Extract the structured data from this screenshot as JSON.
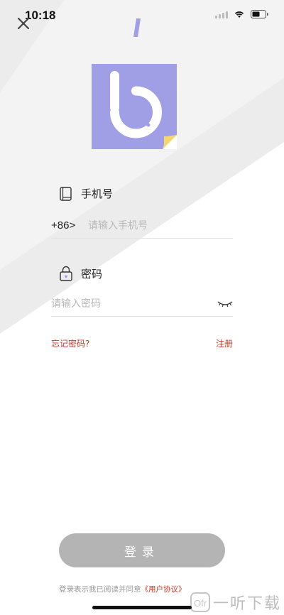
{
  "status_bar": {
    "time": "10:18",
    "icons": [
      "signal-icon",
      "wifi-icon",
      "battery-icon"
    ]
  },
  "nav": {
    "close_icon": "close-icon"
  },
  "logo": {
    "letter": "b",
    "brand_color": "#a09fe6",
    "corner_color": "#f6d76b"
  },
  "phone": {
    "label": "手机号",
    "icon": "phone-book-icon",
    "country_code": "+86>",
    "placeholder": "请输入手机号"
  },
  "password": {
    "label": "密码",
    "icon": "lock-icon",
    "placeholder": "请输入密码",
    "toggle_icon": "eye-closed-icon"
  },
  "links": {
    "forgot": "忘记密码?",
    "register": "注册"
  },
  "login_button": {
    "label": "登录"
  },
  "agreement": {
    "prefix": "登录表示我已阅读并同意",
    "protocol": "《用户协议》"
  },
  "watermark": {
    "text": "一听下载"
  },
  "colors": {
    "accent": "#a09fe6",
    "link": "#c0392b",
    "button": "#b4b4b4"
  }
}
